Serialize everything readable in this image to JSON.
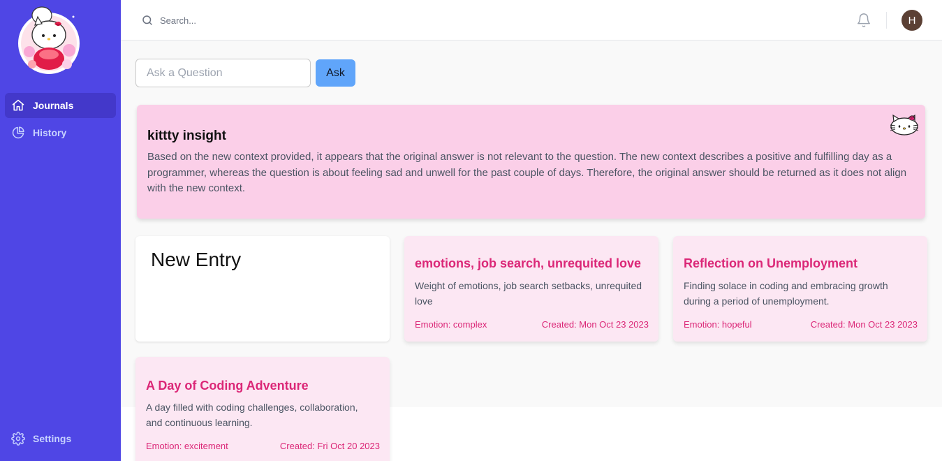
{
  "sidebar": {
    "items": [
      {
        "label": "Journals",
        "icon": "home-icon",
        "active": true
      },
      {
        "label": "History",
        "icon": "pie-chart-icon",
        "active": false
      }
    ],
    "settings": {
      "label": "Settings",
      "icon": "gear-icon"
    }
  },
  "topbar": {
    "search_placeholder": "Search...",
    "avatar_initial": "H"
  },
  "ask": {
    "placeholder": "Ask a Question",
    "button_label": "Ask"
  },
  "insight": {
    "title": "kittty insight",
    "text": "Based on the new context provided, it appears that the original answer is not relevant to the question. The new context describes a positive and fulfilling day as a programmer, whereas the question is about feeling sad and unwell for the past couple of days. Therefore, the original answer should be returned as it does not align with the new context."
  },
  "new_entry": {
    "label": "New Entry"
  },
  "entries": [
    {
      "title": "emotions, job search, unrequited love",
      "summary": "Weight of emotions, job search setbacks, unrequited love",
      "emotion": "Emotion: complex",
      "created": "Created: Mon Oct 23 2023"
    },
    {
      "title": "Reflection on Unemployment",
      "summary": "Finding solace in coding and embracing growth during a period of unemployment.",
      "emotion": "Emotion: hopeful",
      "created": "Created: Mon Oct 23 2023"
    },
    {
      "title": "A Day of Coding Adventure",
      "summary": "A day filled with coding challenges, collaboration, and continuous learning.",
      "emotion": "Emotion: excitement",
      "created": "Created: Fri Oct 20 2023"
    }
  ],
  "colors": {
    "sidebar": "#4f46e5",
    "sidebar_active": "#4338ca",
    "accent_pink": "#db2777",
    "insight_bg": "#fbcfe8",
    "card_bg": "#fce7f3",
    "ask_button": "#60a5fa"
  }
}
